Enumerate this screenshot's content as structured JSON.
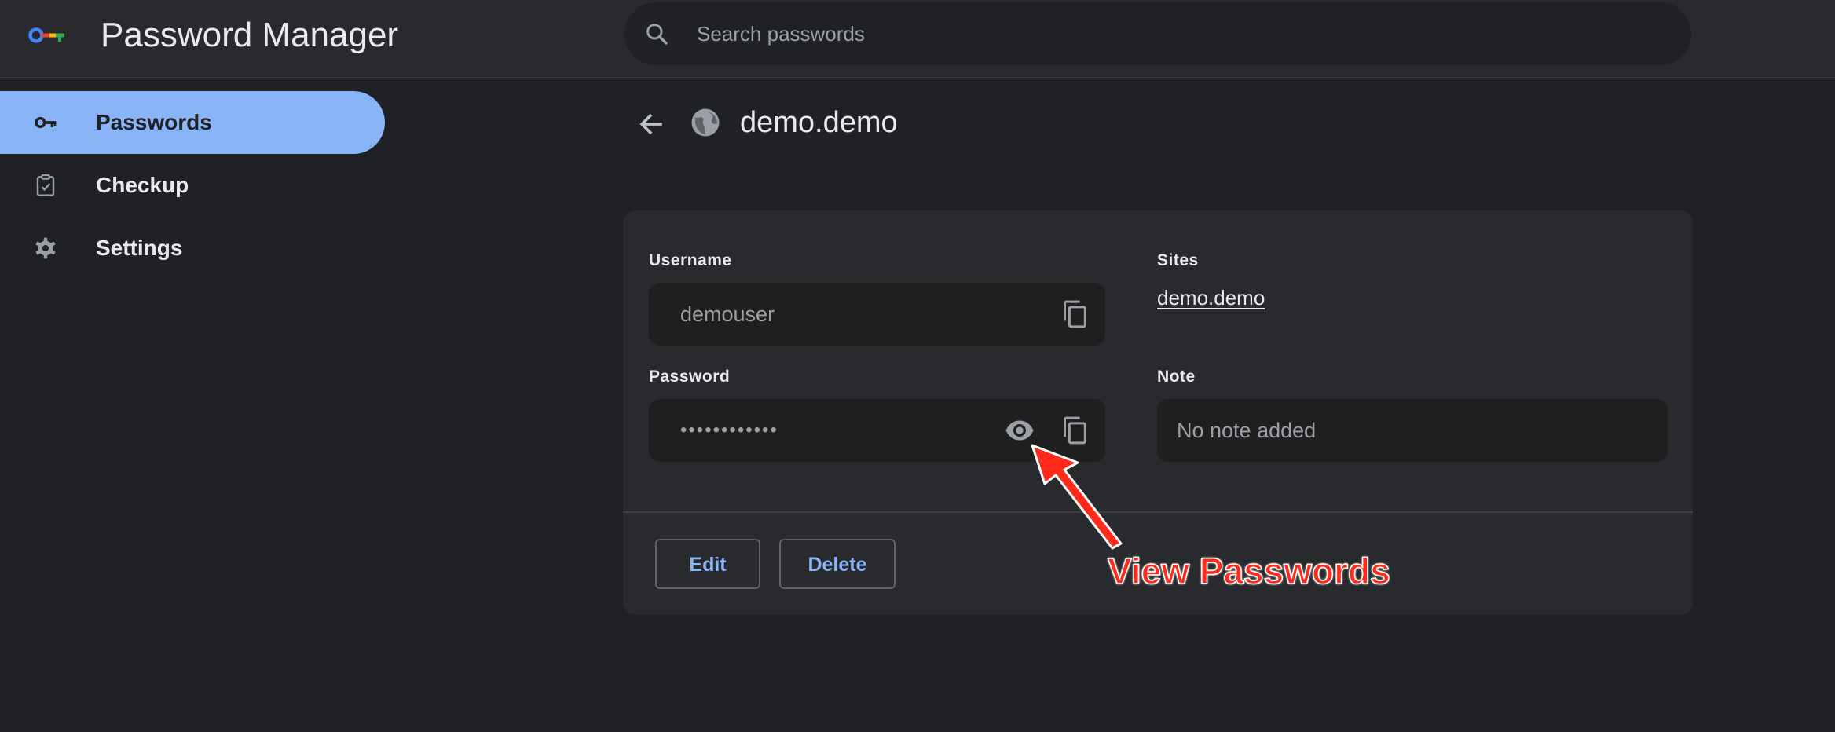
{
  "header": {
    "app_title": "Password Manager",
    "logo_icon": "password-key-logo-icon",
    "search": {
      "placeholder": "Search passwords",
      "value": "",
      "icon": "search-icon"
    }
  },
  "sidebar": {
    "items": [
      {
        "label": "Passwords",
        "icon": "key-icon",
        "active": true
      },
      {
        "label": "Checkup",
        "icon": "clipboard-check-icon",
        "active": false
      },
      {
        "label": "Settings",
        "icon": "gear-icon",
        "active": false
      }
    ]
  },
  "page": {
    "title": "demo.demo",
    "back_icon": "arrow-left-icon",
    "site_icon": "globe-icon"
  },
  "details": {
    "username_label": "Username",
    "username_value": "demouser",
    "password_label": "Password",
    "password_value": "••••••••••••",
    "sites_label": "Sites",
    "site_link": "demo.demo",
    "note_label": "Note",
    "note_value": "No note added",
    "edit_label": "Edit",
    "delete_label": "Delete"
  },
  "annotation": {
    "text": "View Passwords"
  },
  "colors": {
    "background": "#202124",
    "header": "#292a2d",
    "accent": "#8ab4f8",
    "field": "#1f1f1f",
    "annotation": "#ff2a1a"
  }
}
